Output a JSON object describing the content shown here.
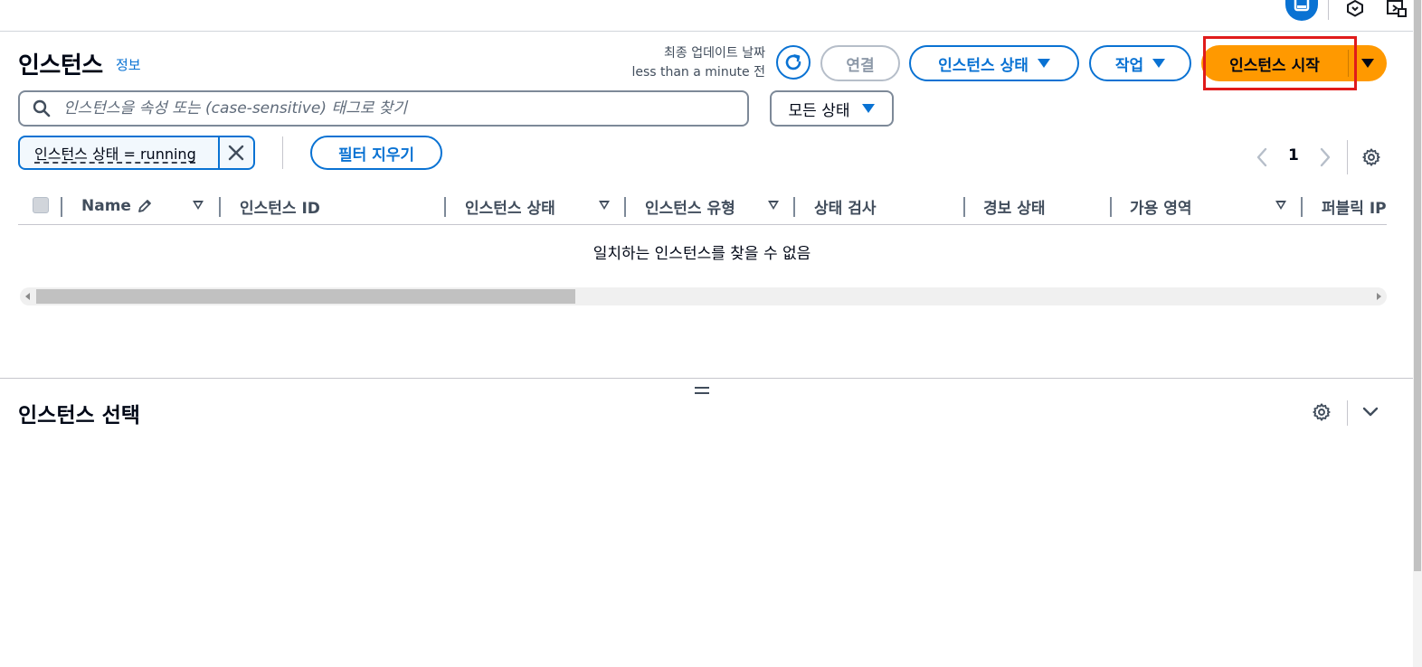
{
  "header": {
    "title": "인스턴스",
    "info_link": "정보",
    "updated_label": "최종 업데이트 날짜",
    "updated_value": "less than a minute 전"
  },
  "toolbar": {
    "connect_label": "연결",
    "instance_state_label": "인스턴스 상태",
    "actions_label": "작업",
    "launch_label": "인스턴스 시작"
  },
  "search": {
    "placeholder": "인스턴스을 속성 또는 (case-sensitive) 태그로 찾기",
    "value": ""
  },
  "state_filter": {
    "selected": "모든 상태"
  },
  "filters": {
    "token_label": "인스턴스 상태 = running",
    "clear_label": "필터 지우기"
  },
  "pagination": {
    "current_page": "1"
  },
  "table": {
    "columns": [
      "Name",
      "인스턴스 ID",
      "인스턴스 상태",
      "인스턴스 유형",
      "상태 검사",
      "경보 상태",
      "가용 영역",
      "퍼블릭 IP"
    ],
    "empty_message": "일치하는 인스턴스를 찾을 수 없음",
    "horizontal_scroll_fraction": 0.4
  },
  "split_panel": {
    "title": "인스턴스 선택"
  },
  "colors": {
    "primary_blue": "#0972d3",
    "launch_orange": "#ff9900",
    "highlight_red": "#e01b1b",
    "text_dark": "#000716"
  }
}
